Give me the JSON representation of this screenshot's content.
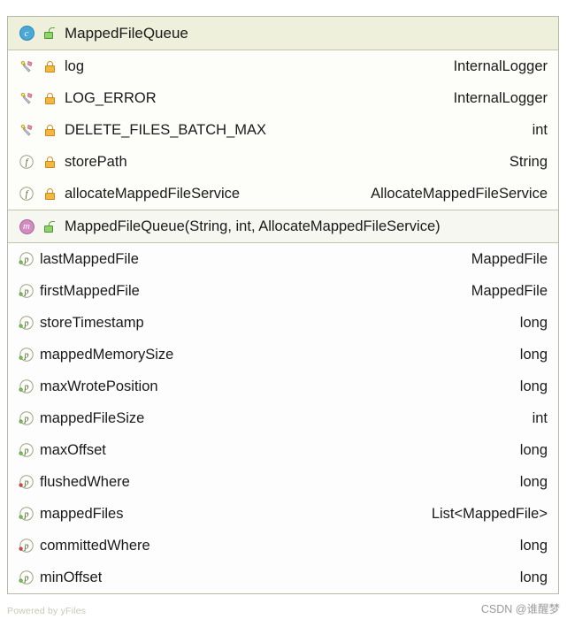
{
  "diagram": {
    "type": "uml-class",
    "header": {
      "stereotype_icon": "class-badge-icon",
      "visibility_icon": "unlock-icon",
      "name": "MappedFileQueue"
    },
    "sections": [
      {
        "name": "fields",
        "rows": [
          {
            "kind_icon": "static-field-icon",
            "visibility_icon": "lock-icon",
            "name": "log",
            "type": "InternalLogger"
          },
          {
            "kind_icon": "static-field-icon",
            "visibility_icon": "lock-icon",
            "name": "LOG_ERROR",
            "type": "InternalLogger"
          },
          {
            "kind_icon": "static-field-icon",
            "visibility_icon": "lock-icon",
            "name": "DELETE_FILES_BATCH_MAX",
            "type": "int"
          },
          {
            "kind_icon": "field-icon",
            "visibility_icon": "lock-icon",
            "name": "storePath",
            "type": "String"
          },
          {
            "kind_icon": "field-icon",
            "visibility_icon": "lock-icon",
            "name": "allocateMappedFileService",
            "type": "AllocateMappedFileService"
          }
        ]
      },
      {
        "name": "constructors",
        "rows": [
          {
            "kind_icon": "method-badge-icon",
            "visibility_icon": "unlock-icon",
            "name": "MappedFileQueue(String, int, AllocateMappedFileService)",
            "type": ""
          }
        ]
      },
      {
        "name": "properties",
        "rows": [
          {
            "kind_icon": "property-icon",
            "visibility_icon": "",
            "name": "lastMappedFile",
            "type": "MappedFile"
          },
          {
            "kind_icon": "property-icon",
            "visibility_icon": "",
            "name": "firstMappedFile",
            "type": "MappedFile"
          },
          {
            "kind_icon": "property-icon",
            "visibility_icon": "",
            "name": "storeTimestamp",
            "type": "long"
          },
          {
            "kind_icon": "property-icon",
            "visibility_icon": "",
            "name": "mappedMemorySize",
            "type": "long"
          },
          {
            "kind_icon": "property-icon",
            "visibility_icon": "",
            "name": "maxWrotePosition",
            "type": "long"
          },
          {
            "kind_icon": "property-icon",
            "visibility_icon": "",
            "name": "mappedFileSize",
            "type": "int"
          },
          {
            "kind_icon": "property-icon",
            "visibility_icon": "",
            "name": "maxOffset",
            "type": "long"
          },
          {
            "kind_icon": "property-icon",
            "visibility_icon": "",
            "name": "flushedWhere",
            "type": "long"
          },
          {
            "kind_icon": "property-icon",
            "visibility_icon": "",
            "name": "mappedFiles",
            "type": "List<MappedFile>"
          },
          {
            "kind_icon": "property-icon",
            "visibility_icon": "",
            "name": "committedWhere",
            "type": "long"
          },
          {
            "kind_icon": "property-icon",
            "visibility_icon": "",
            "name": "minOffset",
            "type": "long"
          }
        ]
      }
    ]
  },
  "watermarks": {
    "left": "Powered by yFiles",
    "right": "CSDN @谁醒梦"
  },
  "colors": {
    "header_bg": "#eef0dc",
    "border": "#b8b8a8",
    "class_badge": "#4aa8d8",
    "method_badge": "#d08bbf",
    "lock": "#f4b642",
    "unlock": "#8fd46a"
  }
}
